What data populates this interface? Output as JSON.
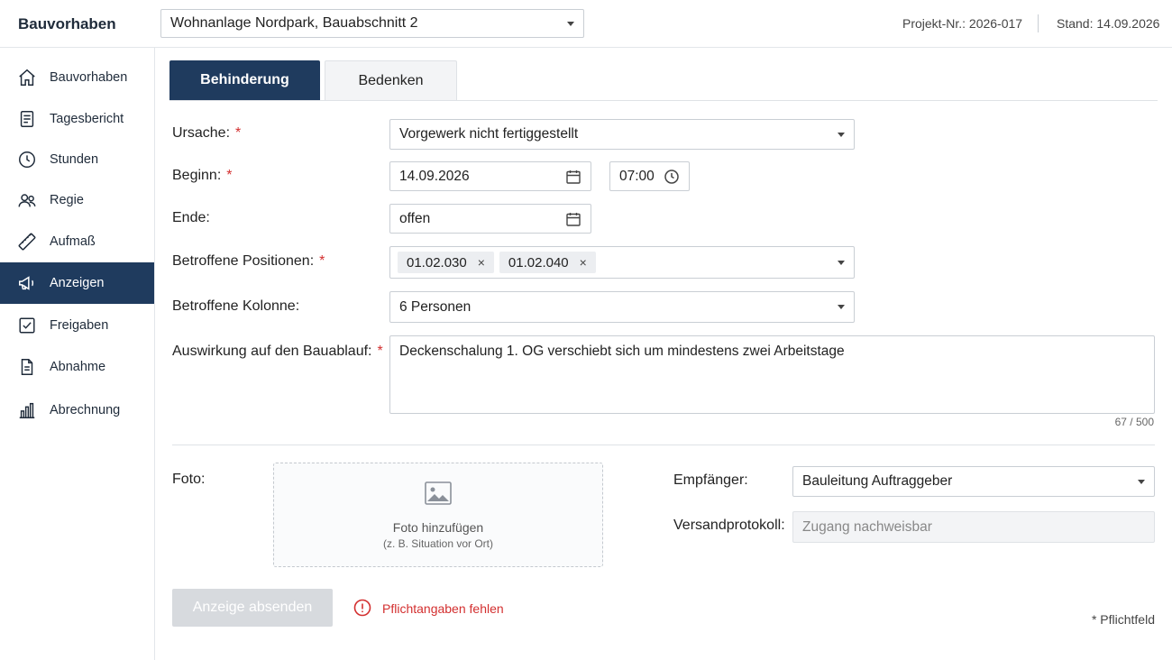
{
  "app": {
    "title": "Bauvorhaben"
  },
  "header": {
    "project": "Wohnanlage Nordpark, Bauabschnitt 2",
    "project_nr": "Projekt-Nr.: 2026-017",
    "stand": "Stand: 14.09.2026"
  },
  "sidebar": {
    "items": [
      {
        "label": "Bauvorhaben",
        "icon": "home-icon",
        "active": false
      },
      {
        "label": "Tagesbericht",
        "icon": "report-icon",
        "active": false
      },
      {
        "label": "Stunden",
        "icon": "clock-icon",
        "active": false
      },
      {
        "label": "Regie",
        "icon": "people-icon",
        "active": false
      },
      {
        "label": "Aufmaß",
        "icon": "ruler-icon",
        "active": false
      },
      {
        "label": "Anzeigen",
        "icon": "megaphone-icon",
        "active": true
      },
      {
        "label": "Freigaben",
        "icon": "checkbox-icon",
        "active": false
      },
      {
        "label": "Abnahme",
        "icon": "document-icon",
        "active": false
      },
      {
        "label": "Abrechnung",
        "icon": "bar-chart-icon",
        "active": false
      }
    ]
  },
  "tabs": [
    {
      "label": "Behinderung",
      "active": true
    },
    {
      "label": "Bedenken",
      "active": false
    }
  ],
  "form": {
    "ursache": {
      "label": "Ursache:",
      "value": "Vorgewerk nicht fertiggestellt",
      "required_mark": "*"
    },
    "beginn": {
      "label": "Beginn:",
      "date": "14.09.2026",
      "time": "07:00",
      "required_mark": "*"
    },
    "ende": {
      "label": "Ende:",
      "value": "offen"
    },
    "positionen": {
      "label": "Betroffene Positionen:",
      "chips": [
        "01.02.030",
        "01.02.040"
      ],
      "remove_glyph": "×",
      "required_mark": "*"
    },
    "kolonne": {
      "label": "Betroffene Kolonne:",
      "value": "6 Personen"
    },
    "auswirkung": {
      "label": "Auswirkung auf den Bauablauf:",
      "value": "Deckenschalung 1. OG verschiebt sich um mindestens zwei Arbeitstage",
      "counter": "67 / 500",
      "required_mark": "*"
    },
    "foto": {
      "label": "Foto:",
      "main": "Foto hinzufügen",
      "sub": "(z. B. Situation vor Ort)"
    },
    "empfaenger": {
      "label": "Empfänger:",
      "value": "Bauleitung Auftraggeber"
    },
    "versandprotokoll": {
      "label": "Versandprotokoll:",
      "placeholder": "Zugang nachweisbar"
    }
  },
  "footer": {
    "submit": "Anzeige absenden",
    "error": "Pflichtangaben fehlen",
    "required_note": "* Pflichtfeld"
  },
  "colors": {
    "primary": "#1f3b5e",
    "error": "#d32f2f",
    "disabled": "#d7dade"
  }
}
